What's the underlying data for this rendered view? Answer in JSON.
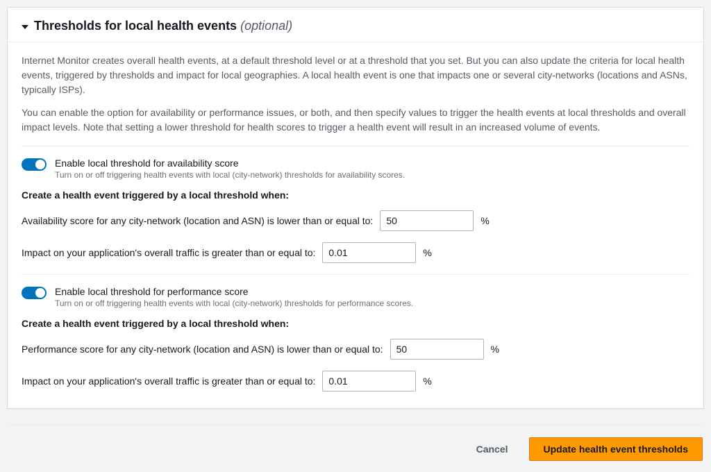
{
  "header": {
    "title": "Thresholds for local health events ",
    "optional": "(optional)"
  },
  "intro": {
    "p1": "Internet Monitor creates overall health events, at a default threshold level or at a threshold that you set. But you can also update the criteria for local health events, triggered by thresholds and impact for local geographies. A local health event is one that impacts one or several city-networks (locations and ASNs, typically ISPs).",
    "p2": "You can enable the option for availability or performance issues, or both, and then specify values to trigger the health events at local thresholds and overall impact levels. Note that setting a lower threshold for health scores to trigger a health event will result in an increased volume of events."
  },
  "availability": {
    "toggle_label": "Enable local threshold for availability score",
    "toggle_hint": "Turn on or off triggering health events with local (city-network) thresholds for availability scores.",
    "subheading": "Create a health event triggered by a local threshold when:",
    "score_label": "Availability score for any city-network (location and ASN) is lower than or equal to:",
    "score_value": "50",
    "score_unit": "%",
    "impact_label": "Impact on your application's overall traffic is greater than or equal to:",
    "impact_value": "0.01",
    "impact_unit": "%"
  },
  "performance": {
    "toggle_label": "Enable local threshold for performance score",
    "toggle_hint": "Turn on or off triggering health events with local (city-network) thresholds for performance scores.",
    "subheading": "Create a health event triggered by a local threshold when:",
    "score_label": "Performance score for any city-network (location and ASN) is lower than or equal to:",
    "score_value": "50",
    "score_unit": "%",
    "impact_label": "Impact on your application's overall traffic is greater than or equal to:",
    "impact_value": "0.01",
    "impact_unit": "%"
  },
  "footer": {
    "cancel": "Cancel",
    "submit": "Update health event thresholds"
  }
}
